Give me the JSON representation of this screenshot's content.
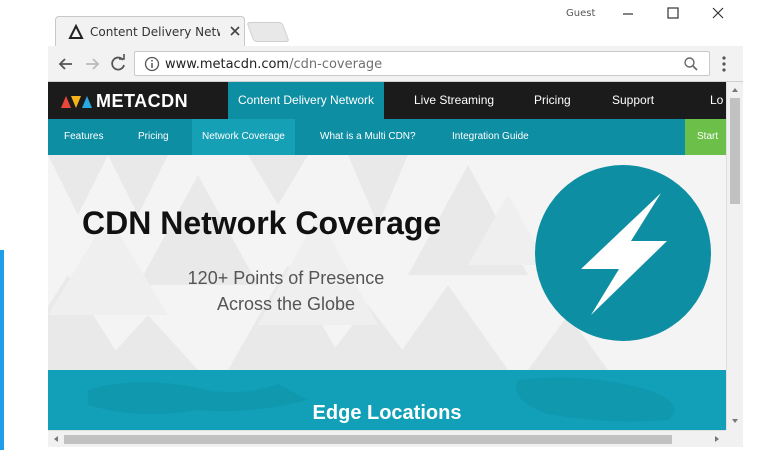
{
  "browser": {
    "tab_title": "Content Delivery Network",
    "profile_label": "Guest",
    "url_domain": "www.metacdn.com",
    "url_path": "/cdn-coverage",
    "icons": [
      "back-icon",
      "forward-icon",
      "reload-icon",
      "info-icon",
      "zoom-icon",
      "menu-icon",
      "minimize-icon",
      "maximize-icon",
      "close-icon"
    ]
  },
  "site": {
    "logo_text": "METACDN",
    "top_nav": [
      {
        "label": "Content Delivery Network",
        "active": true
      },
      {
        "label": "Live Streaming"
      },
      {
        "label": "Pricing"
      },
      {
        "label": "Support"
      },
      {
        "label": "Lo"
      }
    ],
    "sub_nav": [
      {
        "label": "Features"
      },
      {
        "label": "Pricing"
      },
      {
        "label": "Network Coverage",
        "active": true
      },
      {
        "label": "What is a Multi CDN?"
      },
      {
        "label": "Integration Guide"
      }
    ],
    "start_label": "Start",
    "hero": {
      "title": "CDN Network Coverage",
      "subtitle_line1": "120+ Points of Presence",
      "subtitle_line2": "Across the Globe"
    },
    "edge_title": "Edge Locations"
  },
  "colors": {
    "brand_teal": "#0e8ea3",
    "nav_dark": "#1b1b1b",
    "start_green": "#6cc04a",
    "edge_teal": "#12a0b8"
  }
}
